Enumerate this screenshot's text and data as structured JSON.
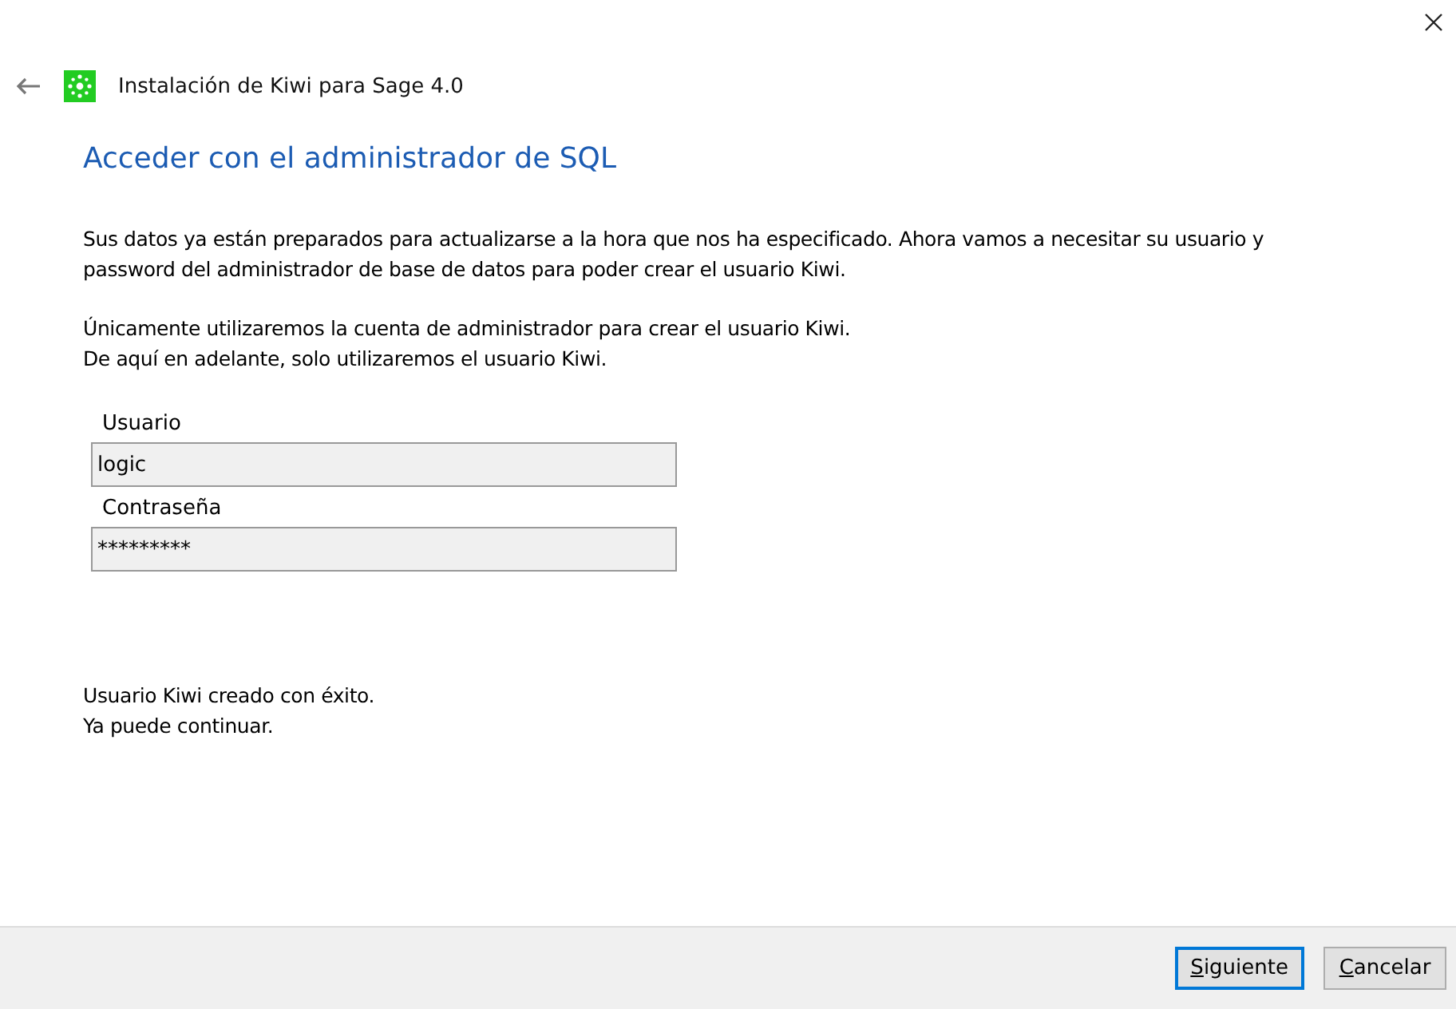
{
  "window": {
    "title": "Instalación de Kiwi para Sage 4.0"
  },
  "heading": "Acceder con el administrador de SQL",
  "paragraphs": [
    "Sus datos ya están preparados para actualizarse a la hora que nos ha especificado. Ahora vamos a necesitar su usuario y password del administrador de base de datos para poder crear el usuario Kiwi.",
    "Únicamente utilizaremos la cuenta de administrador para crear el usuario Kiwi.\nDe aquí en adelante, solo utilizaremos el usuario Kiwi."
  ],
  "fields": [
    {
      "label": "Usuario",
      "value": "logic"
    },
    {
      "label": "Contraseña",
      "value": "*********"
    }
  ],
  "status": "Usuario Kiwi creado con éxito.\nYa puede continuar.",
  "buttons": [
    {
      "label": "Siguiente",
      "default": true
    },
    {
      "label": "Cancelar",
      "default": false
    }
  ]
}
